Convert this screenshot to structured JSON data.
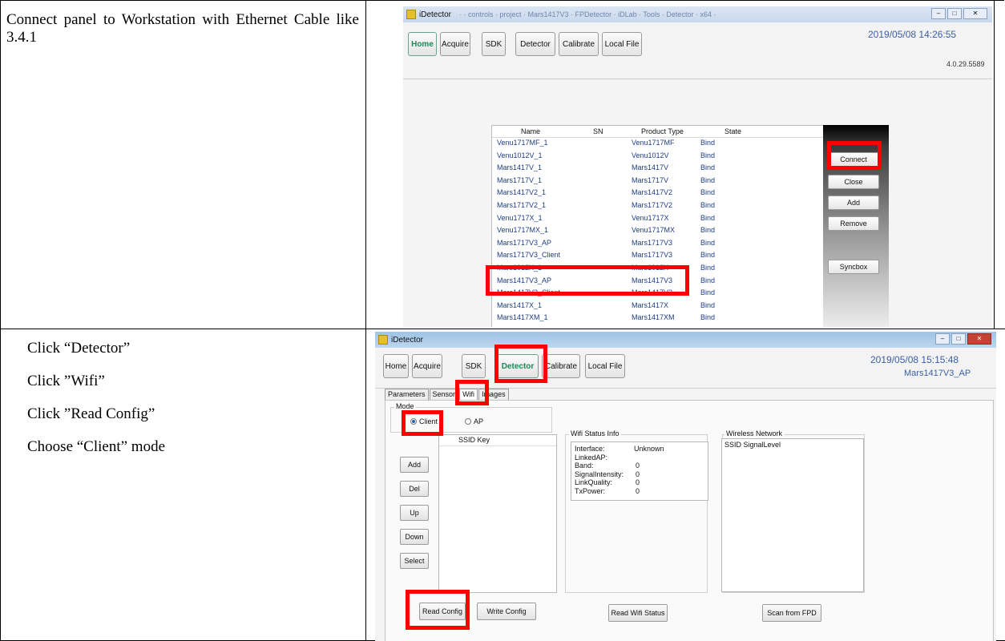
{
  "row1": {
    "instruction": "Connect panel to Workstation with Ethernet Cable like 3.4.1",
    "screenshot": {
      "app_title": "iDetector",
      "title_path": "· · controls · project · Mars1417V3 · FPDetector · iDLab · Tools · Detector · x64 ·",
      "tabs": [
        "Home",
        "Acquire",
        "SDK",
        "Detector",
        "Calibrate",
        "Local File"
      ],
      "datetime": "2019/05/08 14:26:55",
      "version": "4.0.29.5589",
      "list_headers": [
        "Name",
        "SN",
        "Product Type",
        "State"
      ],
      "rows": [
        {
          "name": "Venu1717MF_1",
          "type": "Venu1717MF",
          "state": "Bind"
        },
        {
          "name": "Venu1012V_1",
          "type": "Venu1012V",
          "state": "Bind"
        },
        {
          "name": "Mars1417V_1",
          "type": "Mars1417V",
          "state": "Bind"
        },
        {
          "name": "Mars1717V_1",
          "type": "Mars1717V",
          "state": "Bind"
        },
        {
          "name": "Mars1417V2_1",
          "type": "Mars1417V2",
          "state": "Bind"
        },
        {
          "name": "Mars1717V2_1",
          "type": "Mars1717V2",
          "state": "Bind"
        },
        {
          "name": "Venu1717X_1",
          "type": "Venu1717X",
          "state": "Bind"
        },
        {
          "name": "Venu1717MX_1",
          "type": "Venu1717MX",
          "state": "Bind"
        },
        {
          "name": "Mars1717V3_AP",
          "type": "Mars1717V3",
          "state": "Bind"
        },
        {
          "name": "Mars1717V3_Client",
          "type": "Mars1717V3",
          "state": "Bind"
        },
        {
          "name": "Mars1012X_1",
          "type": "Mars1012X",
          "state": "Bind"
        },
        {
          "name": "Mars1417V3_AP",
          "type": "Mars1417V3",
          "state": "Bind"
        },
        {
          "name": "Mars1417V3_Client",
          "type": "Mars1417V3",
          "state": "Bind"
        },
        {
          "name": "Mars1417X_1",
          "type": "Mars1417X",
          "state": "Bind"
        },
        {
          "name": "Mars1417XM_1",
          "type": "Mars1417XM",
          "state": "Bind"
        }
      ],
      "side_buttons": [
        "Connect",
        "Close",
        "Add",
        "Remove",
        "Syncbox"
      ],
      "window_buttons": [
        "–",
        "□",
        "✕"
      ]
    }
  },
  "row2": {
    "instructions": [
      "Click “Detector”",
      "Click ”Wifi”",
      "Click ”Read Config”",
      "Choose “Client” mode"
    ],
    "screenshot": {
      "app_title": "iDetector",
      "tabs": [
        "Home",
        "Acquire",
        "SDK",
        "Detector",
        "Calibrate",
        "Local File"
      ],
      "datetime": "2019/05/08 15:15:48",
      "detector_name": "Mars1417V3_AP",
      "subtabs": [
        "Parameters",
        "Sensor",
        "Wifi",
        "Images"
      ],
      "mode_label": "Mode",
      "mode_options": [
        "Client",
        "AP"
      ],
      "ssid_header": "SSID Key",
      "left_buttons": [
        "Add",
        "Del",
        "Up",
        "Down",
        "Select"
      ],
      "wifi_status": {
        "title": "Wifi Status Info",
        "items": [
          {
            "k": "Interface:",
            "v": "Unknown"
          },
          {
            "k": "LinkedAP:",
            "v": ""
          },
          {
            "k": "Band:",
            "v": "0"
          },
          {
            "k": "SignalIntensity:",
            "v": "0"
          },
          {
            "k": "LinkQuality:",
            "v": "0"
          },
          {
            "k": "TxPower:",
            "v": "0"
          }
        ]
      },
      "wireless": {
        "title": "Wireless Network",
        "header": "SSID SignalLevel"
      },
      "bottom_buttons": [
        "Read Config",
        "Write Config",
        "Read Wifi Status",
        "Scan from FPD"
      ],
      "window_buttons": [
        "–",
        "□",
        "✕"
      ]
    }
  }
}
